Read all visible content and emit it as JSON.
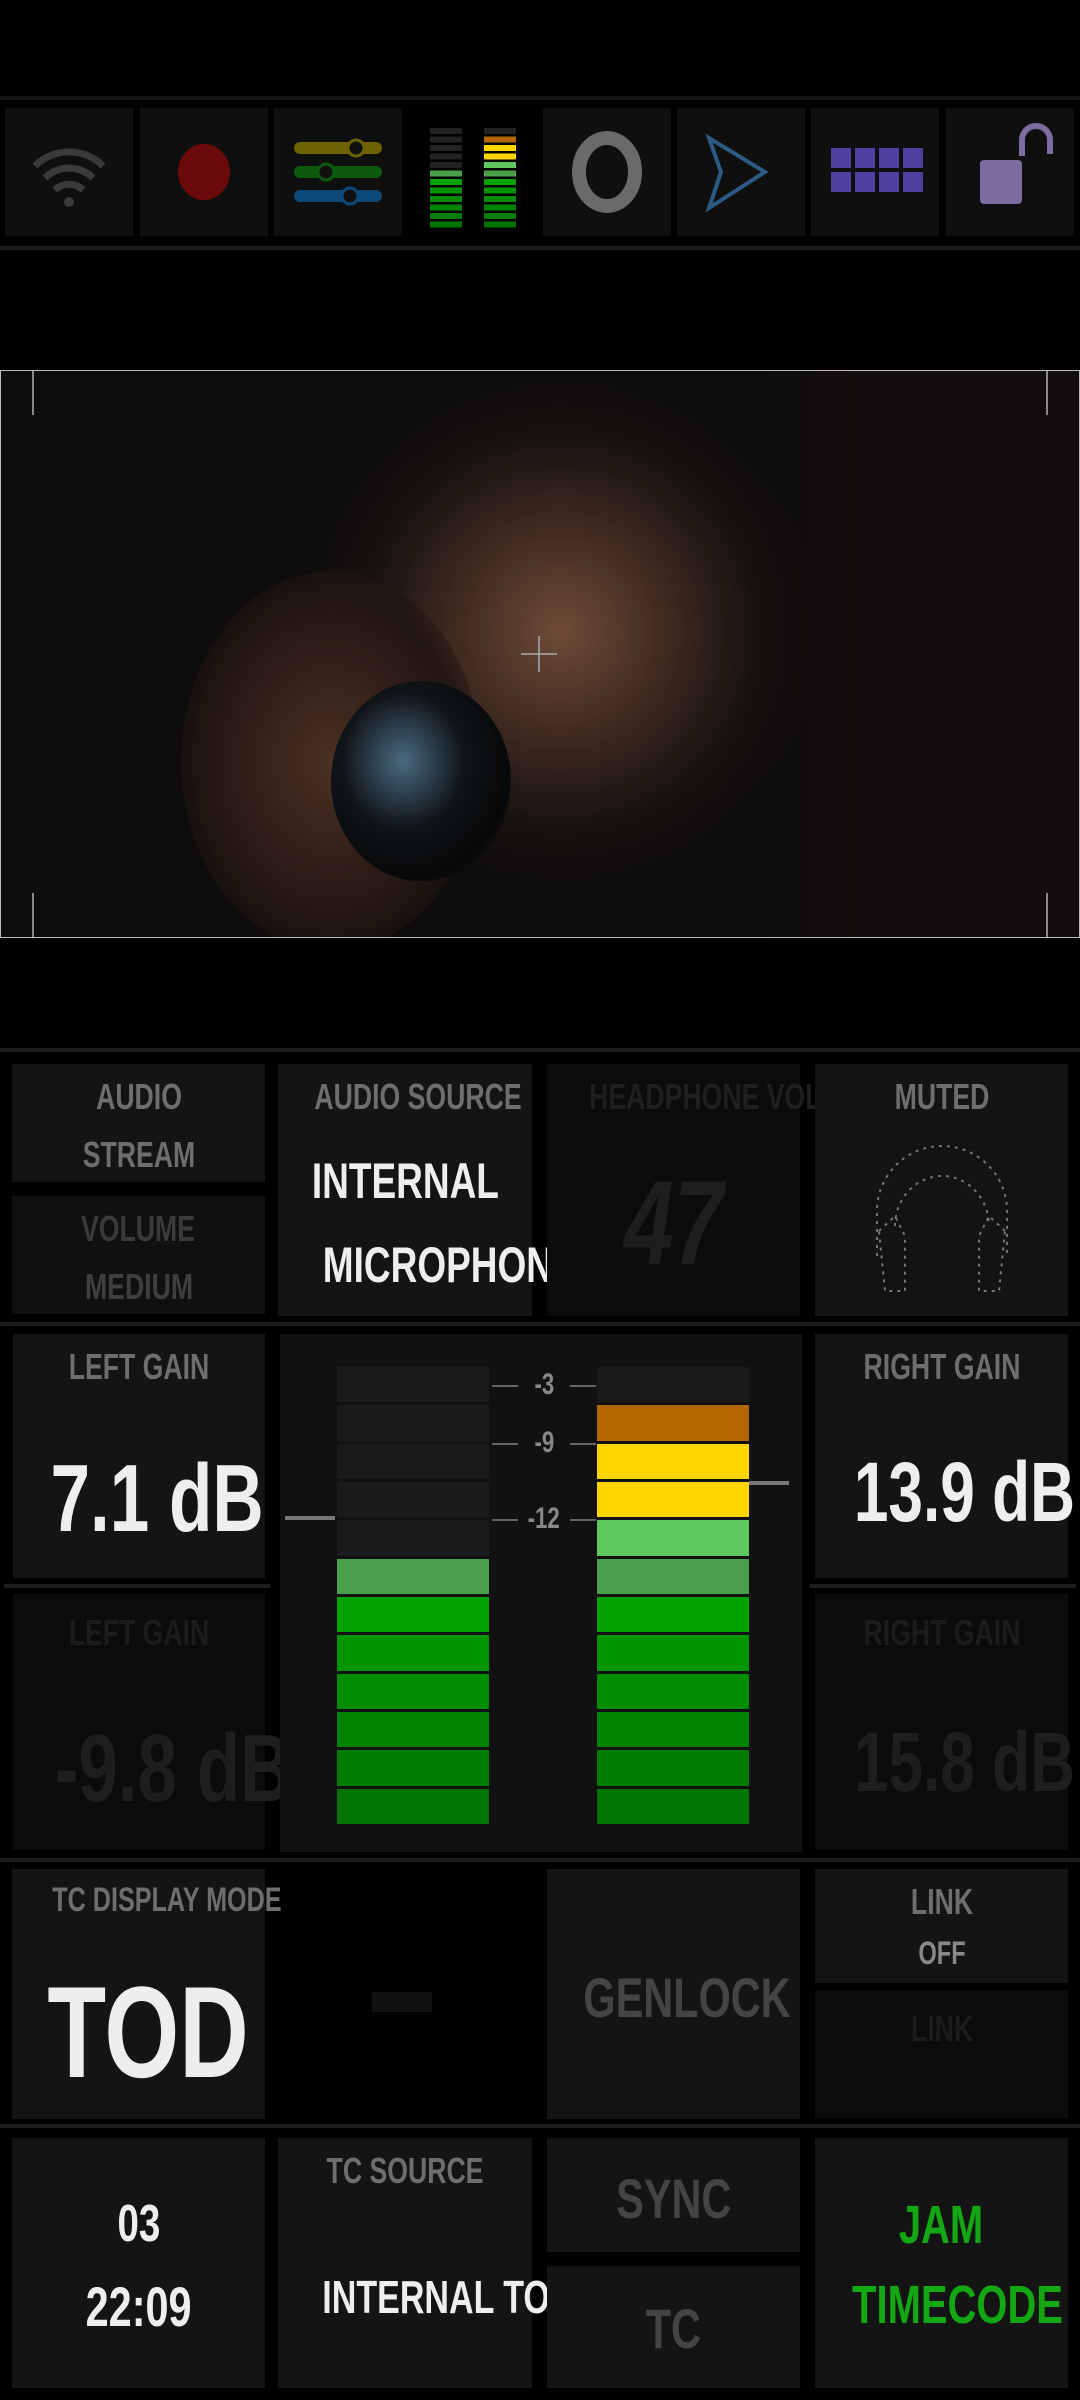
{
  "toolbar": {
    "items": [
      {
        "icon": "wifi-icon"
      },
      {
        "icon": "record-icon",
        "color": "#6a0a0a"
      },
      {
        "icon": "mixer-sliders-icon"
      },
      {
        "icon": "audio-meter-icon"
      },
      {
        "icon": "focus-ring-icon"
      },
      {
        "icon": "send-arrow-icon",
        "color": "#2c5a85"
      },
      {
        "icon": "grid-icon",
        "color": "#4f3fa0"
      },
      {
        "icon": "unlock-icon",
        "color": "#7c6ca0"
      }
    ]
  },
  "audio": {
    "stream_title": "AUDIO",
    "stream_value": "STREAM",
    "volume_title": "VOLUME",
    "volume_value": "MEDIUM",
    "source_title": "AUDIO SOURCE",
    "source_value_line1": "INTERNAL",
    "source_value_line2": "MICROPHONE",
    "headphone_title": "HEADPHONE VOL.",
    "headphone_value": "47",
    "muted_title": "MUTED",
    "muted_icon": "headphones-icon"
  },
  "gain": {
    "left_title": "LEFT GAIN",
    "left_value": "7.1 dB",
    "left_alt_title": "LEFT GAIN",
    "left_alt_value": "-9.8 dB",
    "right_title": "RIGHT GAIN",
    "right_value": "13.9 dB",
    "right_alt_title": "RIGHT GAIN",
    "right_alt_value": "15.8 dB"
  },
  "meter": {
    "scale_labels": [
      "-3",
      "-9",
      "-12"
    ],
    "segments": 12,
    "left_lit": 7,
    "right_lit": 11,
    "segment_colors_top_to_bottom": [
      "#1a1a1a",
      "#b36500",
      "#ffd500",
      "#ffd500",
      "#5fc85c",
      "#4aa04a",
      "#00a300",
      "#009400",
      "#008c00",
      "#008400",
      "#007c00",
      "#007400"
    ]
  },
  "timecode": {
    "display_mode_title": "TC DISPLAY MODE",
    "display_mode_value": "TOD",
    "genlock_label": "GENLOCK",
    "link_title": "LINK",
    "link_value": "OFF",
    "link_alt": "LINK",
    "time_line1": "03",
    "time_line2": "22:09",
    "source_title": "TC SOURCE",
    "source_value": "INTERNAL TOD",
    "sync_label": "SYNC",
    "tc_label": "TC",
    "jam_line1": "JAM",
    "jam_line2": "TIMECODE",
    "jam_color": "#13a813"
  }
}
